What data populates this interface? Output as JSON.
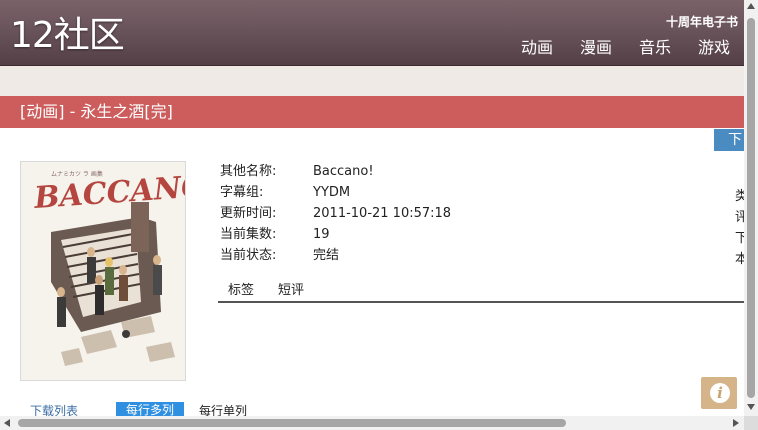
{
  "header": {
    "logo": "12社区",
    "top_link": "十周年电子书",
    "nav": [
      "动画",
      "漫画",
      "音乐",
      "游戏"
    ]
  },
  "title_bar": {
    "text": "[动画] - 永生之酒[完]"
  },
  "download_tab": {
    "label": "下"
  },
  "cover": {
    "title_text": "BACCANO!"
  },
  "info": {
    "rows": [
      {
        "key": "其他名称:",
        "value": "Baccano!"
      },
      {
        "key": "字幕组:",
        "value": "YYDM"
      },
      {
        "key": "更新时间:",
        "value": "2011-10-21 10:57:18"
      },
      {
        "key": "当前集数:",
        "value": "19"
      },
      {
        "key": "当前状态:",
        "value": "完结"
      }
    ],
    "edge_chars": [
      "类",
      "评",
      "下",
      "本"
    ]
  },
  "subtabs": [
    "标签",
    "短评"
  ],
  "bottom": {
    "download_list": "下载列表",
    "multi_col": "每行多列",
    "single_col": "每行单列"
  },
  "colors": {
    "header": "#6a545b",
    "title_bar": "#cd5c5c",
    "accent_blue": "#2f8fe0",
    "info_button": "#d5b48a"
  },
  "icons": {
    "info_button": "info-icon"
  }
}
